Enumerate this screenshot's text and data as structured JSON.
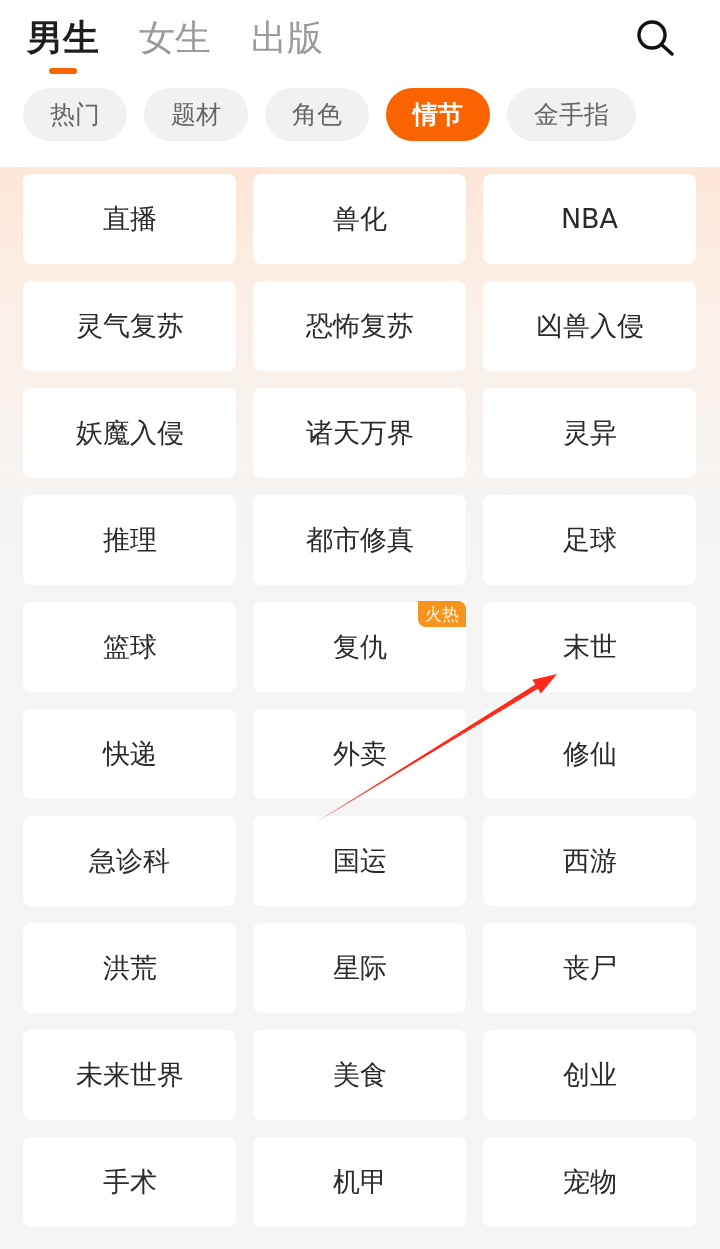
{
  "tabs": [
    {
      "label": "男生",
      "selected": true
    },
    {
      "label": "女生",
      "selected": false
    },
    {
      "label": "出版",
      "selected": false
    }
  ],
  "categories": [
    {
      "label": "热门",
      "selected": false
    },
    {
      "label": "题材",
      "selected": false
    },
    {
      "label": "角色",
      "selected": false
    },
    {
      "label": "情节",
      "selected": true
    },
    {
      "label": "金手指",
      "selected": false
    }
  ],
  "tags": [
    {
      "label": "直播"
    },
    {
      "label": "兽化"
    },
    {
      "label": "NBA"
    },
    {
      "label": "灵气复苏"
    },
    {
      "label": "恐怖复苏"
    },
    {
      "label": "凶兽入侵"
    },
    {
      "label": "妖魔入侵"
    },
    {
      "label": "诸天万界"
    },
    {
      "label": "灵异"
    },
    {
      "label": "推理"
    },
    {
      "label": "都市修真"
    },
    {
      "label": "足球"
    },
    {
      "label": "篮球"
    },
    {
      "label": "复仇",
      "badge": "火热"
    },
    {
      "label": "末世"
    },
    {
      "label": "快递"
    },
    {
      "label": "外卖"
    },
    {
      "label": "修仙"
    },
    {
      "label": "急诊科"
    },
    {
      "label": "国运"
    },
    {
      "label": "西游"
    },
    {
      "label": "洪荒"
    },
    {
      "label": "星际"
    },
    {
      "label": "丧尸"
    },
    {
      "label": "未来世界"
    },
    {
      "label": "美食"
    },
    {
      "label": "创业"
    },
    {
      "label": "手术"
    },
    {
      "label": "机甲"
    },
    {
      "label": "宠物"
    }
  ]
}
